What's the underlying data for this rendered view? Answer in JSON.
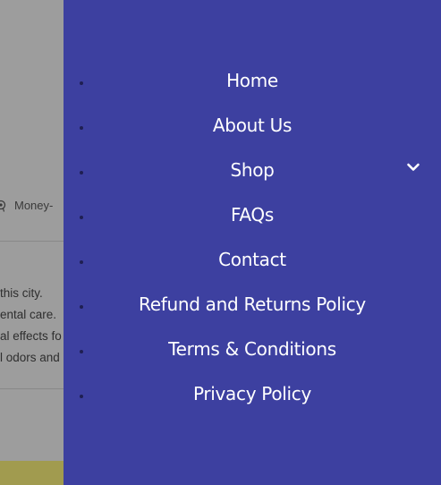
{
  "background_page": {
    "badge_text": "Money-",
    "text_lines": [
      "this city.",
      "ental care.",
      "al effects fo",
      "l odors and"
    ]
  },
  "drawer": {
    "menu_items": [
      {
        "label": "Home"
      },
      {
        "label": "About Us"
      },
      {
        "label": "Shop",
        "has_submenu": true
      },
      {
        "label": "FAQs"
      },
      {
        "label": "Contact"
      },
      {
        "label": "Refund and Returns Policy"
      },
      {
        "label": "Terms & Conditions"
      },
      {
        "label": "Privacy Policy"
      }
    ]
  },
  "colors": {
    "drawer_bg": "#3d40a0",
    "overlay_bg": "#9d9d9d",
    "footer_strip": "#a19b4f",
    "menu_text": "#ffffff"
  },
  "icons": {
    "submenu": "chevron-down-icon",
    "badge": "medal-icon"
  }
}
